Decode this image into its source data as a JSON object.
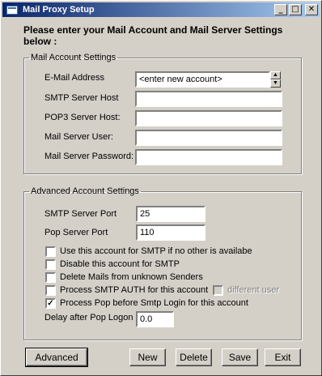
{
  "window": {
    "title": "Mail Proxy Setup",
    "controls": {
      "minimize": "_",
      "maximize": "□",
      "close": "✕"
    }
  },
  "heading": "Please enter your Mail Account and Mail Server Settings below :",
  "account_settings": {
    "legend": "Mail Account Settings",
    "email_label": "E-Mail Address",
    "email_value": "<enter new account>",
    "smtp_host_label": "SMTP Server Host",
    "smtp_host_value": "",
    "pop3_host_label": "POP3 Server Host:",
    "pop3_host_value": "",
    "user_label": "Mail Server User:",
    "user_value": "",
    "password_label": "Mail Server Password:",
    "password_value": ""
  },
  "advanced_settings": {
    "legend": "Advanced Account Settings",
    "smtp_port_label": "SMTP Server Port",
    "smtp_port_value": "25",
    "pop_port_label": "Pop Server Port",
    "pop_port_value": "110",
    "checkboxes": [
      {
        "label": "Use this account for SMTP if no other is availabe",
        "checked": false
      },
      {
        "label": "Disable this account for SMTP",
        "checked": false
      },
      {
        "label": "Delete Mails from unknown Senders",
        "checked": false
      },
      {
        "label": "Process SMTP AUTH for this account",
        "checked": false
      },
      {
        "label": "Process Pop before Smtp Login for this account",
        "checked": true
      }
    ],
    "different_user_label": "different user",
    "different_user_checked": false,
    "delay_label": "Delay after Pop Logon",
    "delay_value": "0.0"
  },
  "buttons": {
    "advanced": "Advanced",
    "new": "New",
    "delete": "Delete",
    "save": "Save",
    "exit": "Exit"
  }
}
